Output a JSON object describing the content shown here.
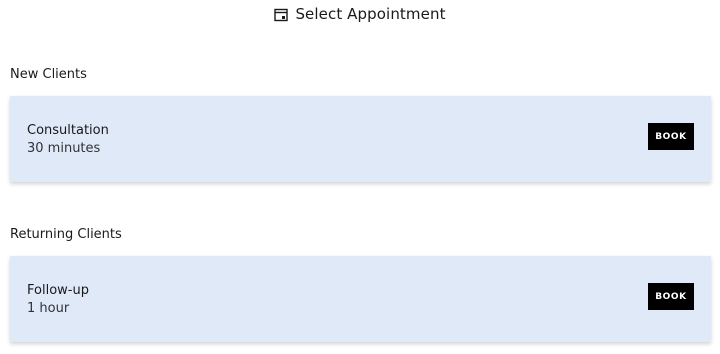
{
  "header": {
    "title": "Select Appointment",
    "icon": "calendar-icon"
  },
  "sections": [
    {
      "title": "New Clients",
      "items": [
        {
          "name": "Consultation",
          "duration": "30 minutes",
          "button_label": "BOOK"
        }
      ]
    },
    {
      "title": "Returning Clients",
      "items": [
        {
          "name": "Follow-up",
          "duration": "1 hour",
          "button_label": "BOOK"
        }
      ]
    }
  ],
  "colors": {
    "card_background": "#dfe9f8",
    "button_background": "#000000",
    "button_text": "#ffffff"
  }
}
